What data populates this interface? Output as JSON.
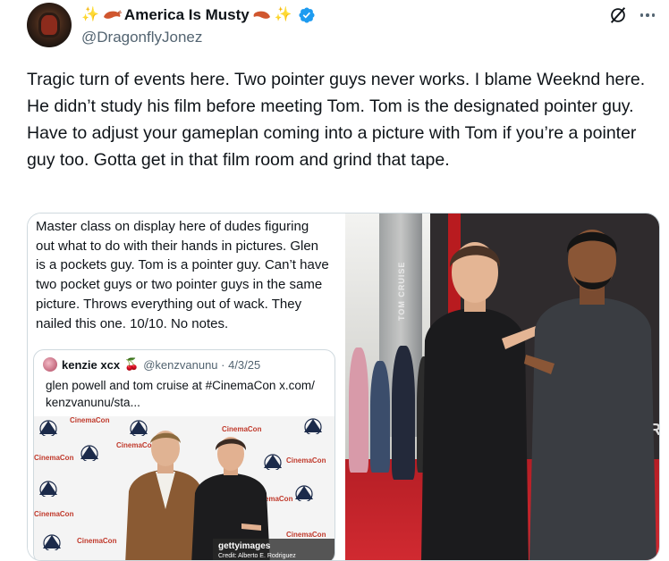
{
  "author": {
    "display_name": "America Is Musty",
    "emoji_left": "✨",
    "emoji_right": "✨",
    "handle": "@DragonflyJonez"
  },
  "tweet": {
    "text": "Tragic turn of events here. Two pointer guys never works. I blame Weeknd here. He didn’t study his film before meeting Tom. Tom is the designated pointer guy. Have to adjust your gameplan coming into a picture with Tom if you’re a pointer guy too. Gotta get in that film room and grind that tape."
  },
  "media": {
    "quote_text": "Master class on display here of dudes figuring out what to do with their hands in pictures. Glen is a pockets guy. Tom is a pointer guy. Can’t have two pocket guys or two pointer guys in the same picture. Throws everything out of wack. They nailed this one. 10/10. No notes.",
    "quoted_tweet": {
      "name": "kenzie xcx",
      "emoji": "🍒",
      "handle_date": "@kenzvanunu · 4/3/25",
      "text": "glen powell and tom cruise at #CinemaCon x.com/ kenzvanunu/sta..."
    },
    "backdrop_brand": "CinemaCon",
    "photo_credit_logo": "gettyimages",
    "photo_credit": "Credit: Alberto E. Rodriguez",
    "wall_text": "TOM CRUISE",
    "wall_letter": "R"
  },
  "icons": {
    "verified": "verified-badge-icon",
    "grok": "grok-icon",
    "more": "more-icon"
  },
  "colors": {
    "verified_blue": "#1d9bf0",
    "text_primary": "#0f1419",
    "text_secondary": "#536471",
    "border": "#cfd9de",
    "carpet_red": "#c8232a"
  }
}
